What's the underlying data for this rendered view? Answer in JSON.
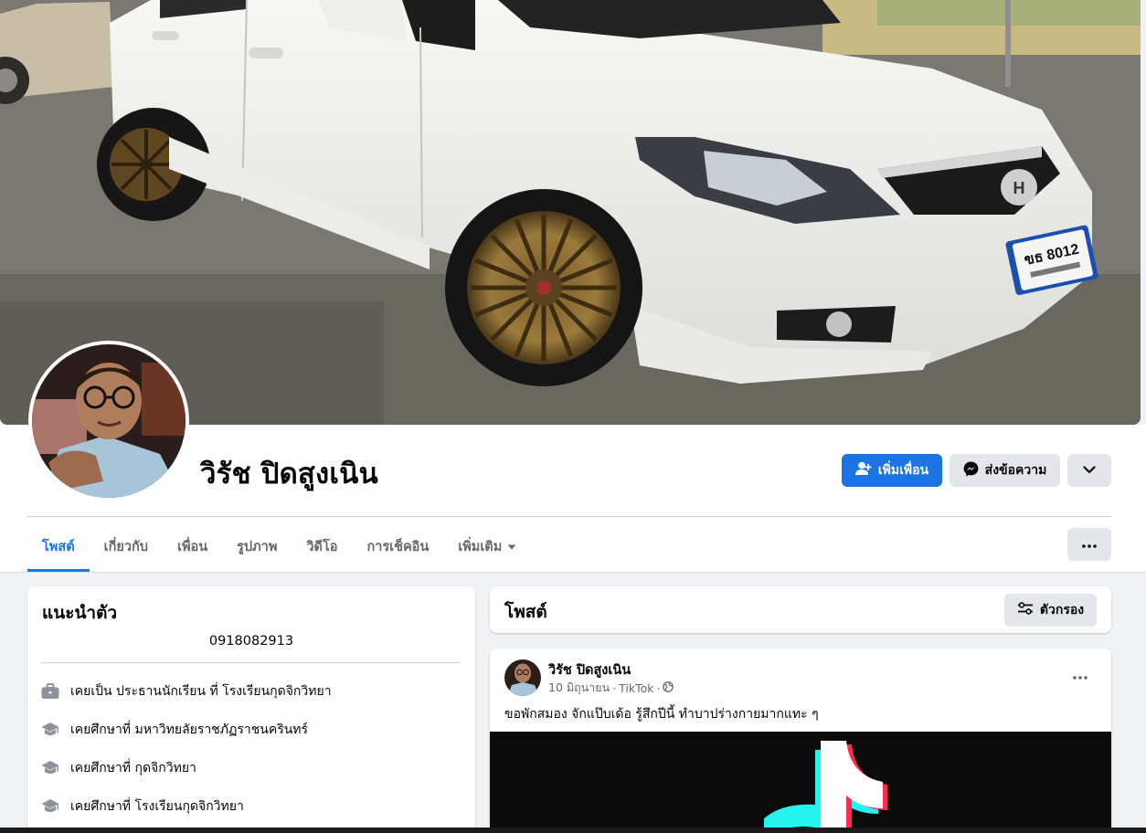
{
  "profile": {
    "name": "วิรัช ปิดสูงเนิน"
  },
  "actions": {
    "add_friend_label": "เพิ่มเพื่อน",
    "message_label": "ส่งข้อความ"
  },
  "tabs": [
    {
      "label": "โพสต์",
      "active": true
    },
    {
      "label": "เกี่ยวกับ",
      "active": false
    },
    {
      "label": "เพื่อน",
      "active": false
    },
    {
      "label": "รูปภาพ",
      "active": false
    },
    {
      "label": "วิดีโอ",
      "active": false
    },
    {
      "label": "การเช็คอิน",
      "active": false
    },
    {
      "label": "เพิ่มเติม",
      "active": false
    }
  ],
  "intro": {
    "title": "แนะนำตัว",
    "phone": "0918082913",
    "items": [
      {
        "icon": "briefcase-icon",
        "text": "เคยเป็น ประธานนักเรียน ที่ โรงเรียนกุดจิกวิทยา"
      },
      {
        "icon": "graduation-cap-icon",
        "text": "เคยศึกษาที่ มหาวิทยลัยราชภัฏราชนครินทร์"
      },
      {
        "icon": "graduation-cap-icon",
        "text": "เคยศึกษาที่ กุดจิกวิทยา"
      },
      {
        "icon": "graduation-cap-icon",
        "text": "เคยศึกษาที่ โรงเรียนกุดจิกวิทยา"
      }
    ]
  },
  "posts_section": {
    "title": "โพสต์",
    "filter_label": "ตัวกรอง"
  },
  "post": {
    "author": "วิรัช ปิดสูงเนิน",
    "date": "10 มิถุนายน",
    "source": "TikTok",
    "audience_icon": "globe-icon",
    "text": "ขอพักสมอง จักแป๊บเด้อ รู้สึกปีนี้ ทำบาปร่างกายมากแทะ ๆ"
  },
  "cover": {
    "license_plate": "ขธ 8012"
  },
  "colors": {
    "accent": "#1b74e4",
    "secondary_button": "#e4e6eb",
    "page_background": "#f0f2f5",
    "muted_text": "#65676b"
  }
}
